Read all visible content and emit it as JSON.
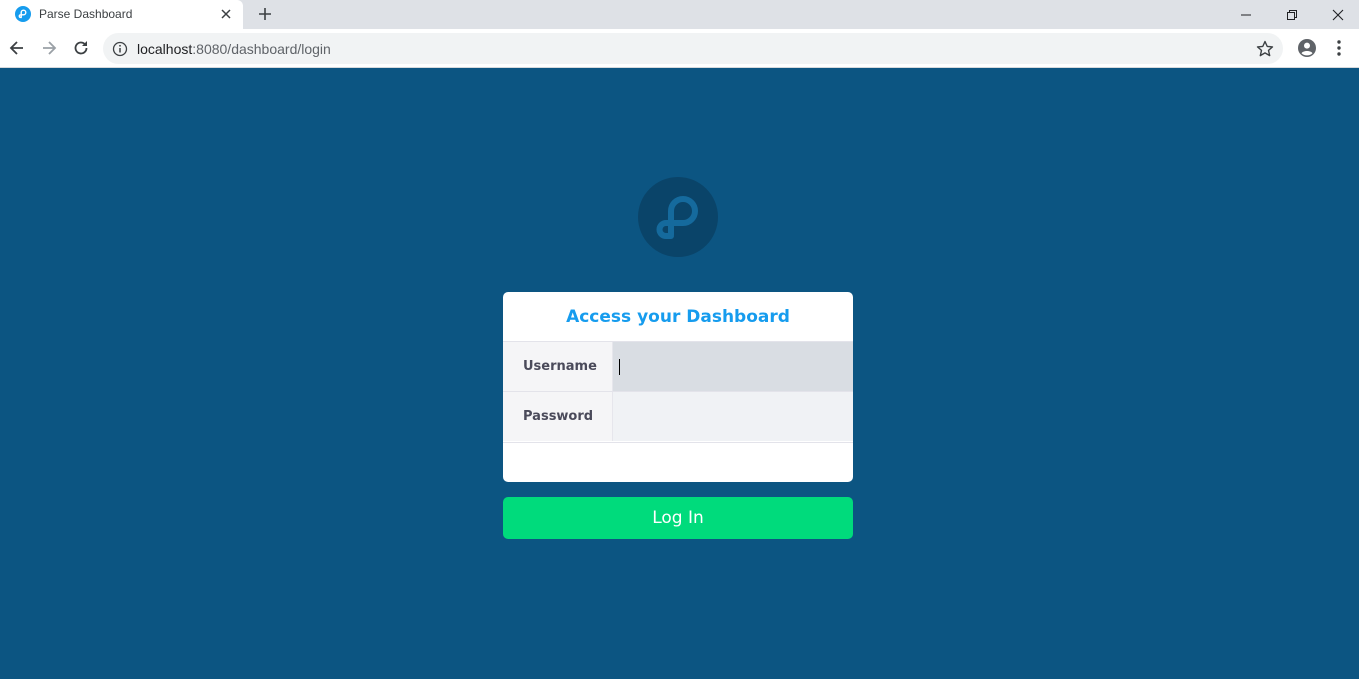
{
  "browser": {
    "tab_title": "Parse Dashboard",
    "url_host": "localhost",
    "url_rest": ":8080/dashboard/login"
  },
  "login": {
    "heading": "Access your Dashboard",
    "username_label": "Username",
    "username_value": "",
    "password_label": "Password",
    "password_value": "",
    "button_label": "Log In"
  },
  "colors": {
    "page_background": "#0c5582",
    "heading": "#169cee",
    "login_button": "#00db7c"
  },
  "icons": [
    "parse-favicon-icon",
    "close-icon",
    "plus-icon",
    "minimize-icon",
    "restore-icon",
    "window-close-icon",
    "back-arrow-icon",
    "forward-arrow-icon",
    "reload-icon",
    "info-icon",
    "star-icon",
    "profile-icon",
    "kebab-menu-icon",
    "parse-logo-icon"
  ]
}
